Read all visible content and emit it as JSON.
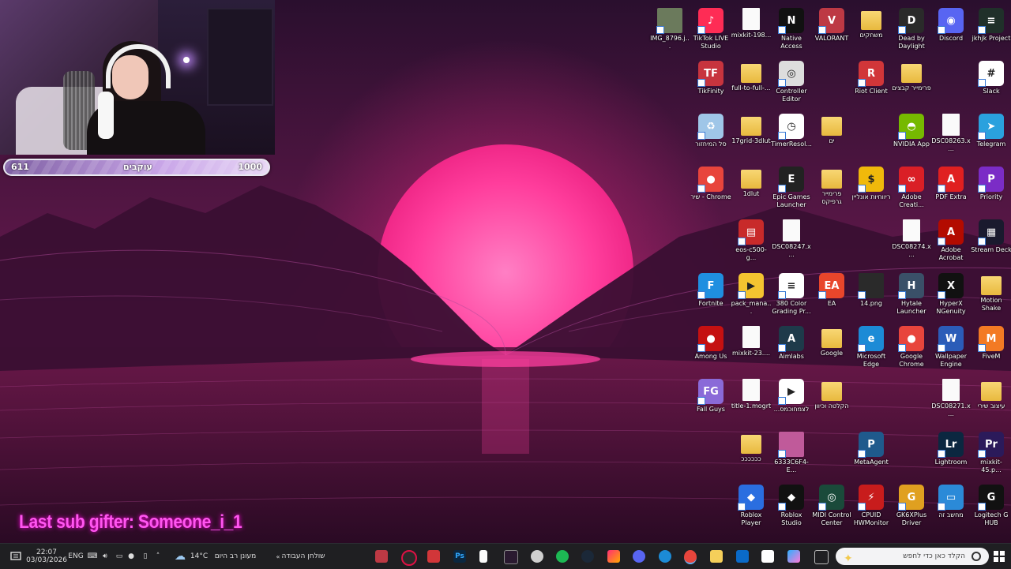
{
  "overlay": {
    "goal_left": "611",
    "goal_label": "עוקבים",
    "goal_right": "1000",
    "goal_fraction": 0.611,
    "last_sub_gifter": "Last sub gifter: Someone_i_1"
  },
  "desktop_icons": [
    {
      "label": "IMG_8796.j...",
      "icon": "image-file-icon",
      "color": "#6b7a5c",
      "kind": "thumb"
    },
    {
      "label": "TikTok LIVE Studio",
      "icon": "tiktok-live-icon",
      "color": "#fe2c55",
      "kind": "app",
      "glyph": "♪"
    },
    {
      "label": "mixkit-198...",
      "icon": "file-icon",
      "color": "#fafafa",
      "kind": "file"
    },
    {
      "label": "Native Access",
      "icon": "native-access-icon",
      "color": "#111111",
      "kind": "app",
      "glyph": "N"
    },
    {
      "label": "VALORANT",
      "icon": "valorant-icon",
      "color": "#bd3944",
      "kind": "app",
      "glyph": "V"
    },
    {
      "label": "משחקים",
      "icon": "folder-icon",
      "color": "#f5cf5a",
      "kind": "folder"
    },
    {
      "label": "Dead by Daylight",
      "icon": "dead-by-daylight-icon",
      "color": "#2a2a2a",
      "kind": "app",
      "glyph": "D"
    },
    {
      "label": "Discord",
      "icon": "discord-icon",
      "color": "#5865f2",
      "kind": "app",
      "glyph": "◉"
    },
    {
      "label": "jkhjk Project",
      "icon": "project-icon",
      "color": "#20302a",
      "kind": "app",
      "glyph": "≡"
    },
    {
      "label": "TikFinity",
      "icon": "tikfinity-icon",
      "color": "#c7343e",
      "kind": "app",
      "glyph": "TF"
    },
    {
      "label": "full-to-full-...",
      "icon": "folder-icon",
      "color": "#f5cf5a",
      "kind": "folder"
    },
    {
      "label": "Controller Editor",
      "icon": "controller-editor-icon",
      "color": "#dddddd",
      "kind": "app",
      "glyph": "◎"
    },
    {
      "label": "Riot Client",
      "icon": "riot-client-icon",
      "color": "#d13639",
      "kind": "app",
      "glyph": "R"
    },
    {
      "label": "פרימייר קבצים",
      "icon": "folder-icon",
      "color": "#f5cf5a",
      "kind": "folder"
    },
    {
      "label": "Slack",
      "icon": "slack-icon",
      "color": "#ffffff",
      "kind": "app",
      "glyph": "#"
    },
    {
      "label": "סל המיחזור",
      "icon": "recycle-bin-icon",
      "color": "#9fc6e8",
      "kind": "app",
      "glyph": "♻"
    },
    {
      "label": "17grid-3dlut",
      "icon": "folder-icon",
      "color": "#f5cf5a",
      "kind": "folder"
    },
    {
      "label": "TimerResol...",
      "icon": "timer-resolution-icon",
      "color": "#ffffff",
      "kind": "app",
      "glyph": "◷"
    },
    {
      "label": "ים",
      "icon": "zip-folder-icon",
      "color": "#f5cf5a",
      "kind": "folder"
    },
    {
      "label": "NVIDIA App",
      "icon": "nvidia-icon",
      "color": "#76b900",
      "kind": "app",
      "glyph": "◓"
    },
    {
      "label": "DSC08263.x...",
      "icon": "file-icon",
      "color": "#fafafa",
      "kind": "file"
    },
    {
      "label": "Telegram",
      "icon": "telegram-icon",
      "color": "#2aa1de",
      "kind": "app",
      "glyph": "➤"
    },
    {
      "label": "שיר - Chrome",
      "icon": "chrome-icon",
      "color": "#e8453c",
      "kind": "app",
      "glyph": "●"
    },
    {
      "label": "1dlut",
      "icon": "folder-icon",
      "color": "#f5cf5a",
      "kind": "folder"
    },
    {
      "label": "Epic Games Launcher",
      "icon": "epic-games-icon",
      "color": "#222222",
      "kind": "app",
      "glyph": "E"
    },
    {
      "label": "פרימייר גרפיקס",
      "icon": "zip-folder-icon",
      "color": "#f5cf5a",
      "kind": "folder"
    },
    {
      "label": "ריווחיות אונליין",
      "icon": "coin-icon",
      "color": "#f0b90b",
      "kind": "app",
      "glyph": "$"
    },
    {
      "label": "Adobe Creati...",
      "icon": "adobe-cc-icon",
      "color": "#da1f26",
      "kind": "app",
      "glyph": "∞"
    },
    {
      "label": "PDF Extra",
      "icon": "pdf-extra-icon",
      "color": "#e02020",
      "kind": "app",
      "glyph": "A"
    },
    {
      "label": "Priority",
      "icon": "priority-icon",
      "color": "#7b2cc6",
      "kind": "app",
      "glyph": "P"
    },
    {
      "label": "eos-c500-g...",
      "icon": "archive-icon",
      "color": "#c82a2a",
      "kind": "app",
      "glyph": "▤"
    },
    {
      "label": "DSC08247.x...",
      "icon": "file-icon",
      "color": "#fafafa",
      "kind": "file"
    },
    {
      "label": "DSC08274.x...",
      "icon": "file-icon",
      "color": "#fafafa",
      "kind": "file"
    },
    {
      "label": "Adobe Acrobat",
      "icon": "acrobat-icon",
      "color": "#b30b00",
      "kind": "app",
      "glyph": "A"
    },
    {
      "label": "Stream Deck",
      "icon": "stream-deck-icon",
      "color": "#1a1a2e",
      "kind": "app",
      "glyph": "▦"
    },
    {
      "label": "Fortnite",
      "icon": "fortnite-icon",
      "color": "#1f8fe0",
      "kind": "app",
      "glyph": "F"
    },
    {
      "label": "pack_mana...",
      "icon": "pack-manager-icon",
      "color": "#f4c430",
      "kind": "app",
      "glyph": "▶"
    },
    {
      "label": "380 Color Grading Pr...",
      "icon": "preset-icon",
      "color": "#ffffff",
      "kind": "app",
      "glyph": "≡"
    },
    {
      "label": "EA",
      "icon": "ea-icon",
      "color": "#e8462b",
      "kind": "app",
      "glyph": "EA"
    },
    {
      "label": "14.png",
      "icon": "image-file-icon",
      "color": "#2a2a2a",
      "kind": "thumb"
    },
    {
      "label": "Hytale Launcher",
      "icon": "hytale-icon",
      "color": "#3a5068",
      "kind": "app",
      "glyph": "H"
    },
    {
      "label": "HyperX NGenuity",
      "icon": "hyperx-icon",
      "color": "#111111",
      "kind": "app",
      "glyph": "X"
    },
    {
      "label": "Motion Shake",
      "icon": "zip-folder-icon",
      "color": "#f5cf5a",
      "kind": "folder"
    },
    {
      "label": "Among Us",
      "icon": "among-us-icon",
      "color": "#c51111",
      "kind": "app",
      "glyph": "●"
    },
    {
      "label": "mixkit-23....",
      "icon": "file-icon",
      "color": "#fafafa",
      "kind": "file"
    },
    {
      "label": "Aimlabs",
      "icon": "aimlabs-icon",
      "color": "#1e3a4a",
      "kind": "app",
      "glyph": "A"
    },
    {
      "label": "Google",
      "icon": "zip-folder-icon",
      "color": "#f5cf5a",
      "kind": "folder"
    },
    {
      "label": "Microsoft Edge",
      "icon": "edge-icon",
      "color": "#1c8bd6",
      "kind": "app",
      "glyph": "e"
    },
    {
      "label": "Google Chrome",
      "icon": "chrome-icon",
      "color": "#e8453c",
      "kind": "app",
      "glyph": "●"
    },
    {
      "label": "Wallpaper Engine",
      "icon": "wallpaper-engine-icon",
      "color": "#2b5cb8",
      "kind": "app",
      "glyph": "W"
    },
    {
      "label": "FiveM",
      "icon": "fivem-icon",
      "color": "#f37a24",
      "kind": "app",
      "glyph": "M"
    },
    {
      "label": "Fall Guys",
      "icon": "fall-guys-icon",
      "color": "#8a6ad8",
      "kind": "app",
      "glyph": "FG"
    },
    {
      "label": "title-1.mogrt",
      "icon": "file-icon",
      "color": "#fafafa",
      "kind": "file"
    },
    {
      "label": "...לצמחוכמס",
      "icon": "video-file-icon",
      "color": "#ffffff",
      "kind": "app",
      "glyph": "▶"
    },
    {
      "label": "הקלטה וכיוון",
      "icon": "zip-folder-icon",
      "color": "#f5cf5a",
      "kind": "folder"
    },
    {
      "label": "DSC08271.x...",
      "icon": "file-icon",
      "color": "#fafafa",
      "kind": "file"
    },
    {
      "label": "עיצוב שירי",
      "icon": "zip-folder-icon",
      "color": "#f5cf5a",
      "kind": "folder"
    },
    {
      "label": "ככככככ",
      "icon": "folder-icon",
      "color": "#f5cf5a",
      "kind": "folder"
    },
    {
      "label": "6333C6F4-E...",
      "icon": "image-file-icon",
      "color": "#c05a9a",
      "kind": "thumb"
    },
    {
      "label": "MetaAgent",
      "icon": "metaagent-icon",
      "color": "#1f5a8c",
      "kind": "app",
      "glyph": "P"
    },
    {
      "label": "Lightroom",
      "icon": "lightroom-icon",
      "color": "#0b2740",
      "kind": "app",
      "glyph": "Lr"
    },
    {
      "label": "mixkit-45.p...",
      "icon": "premiere-project-icon",
      "color": "#2b1a5a",
      "kind": "app",
      "glyph": "Pr"
    },
    {
      "label": "Roblox Player",
      "icon": "roblox-icon",
      "color": "#2a6ee0",
      "kind": "app",
      "glyph": "◆"
    },
    {
      "label": "Roblox Studio",
      "icon": "roblox-studio-icon",
      "color": "#111111",
      "kind": "app",
      "glyph": "◆"
    },
    {
      "label": "MIDI Control Center",
      "icon": "midi-icon",
      "color": "#1a4a3a",
      "kind": "app",
      "glyph": "◎"
    },
    {
      "label": "CPUID HWMonitor",
      "icon": "hwmonitor-icon",
      "color": "#c81c1c",
      "kind": "app",
      "glyph": "⚡"
    },
    {
      "label": "GK6XPlus Driver",
      "icon": "gk6x-icon",
      "color": "#e0a020",
      "kind": "app",
      "glyph": "G"
    },
    {
      "label": "מחשב זה",
      "icon": "this-pc-icon",
      "color": "#2b8ad8",
      "kind": "app",
      "glyph": "▭"
    },
    {
      "label": "Logitech G HUB",
      "icon": "logitech-icon",
      "color": "#111111",
      "kind": "app",
      "glyph": "G"
    }
  ],
  "taskbar": {
    "time": "22:07",
    "date": "03/03/2026",
    "language": "ENG",
    "weather_temp": "14°C",
    "weather_text": "מעונן רב היום",
    "desktop_label": "שולחן העבודה",
    "search_placeholder": "הקלד כאן כדי לחפש"
  }
}
